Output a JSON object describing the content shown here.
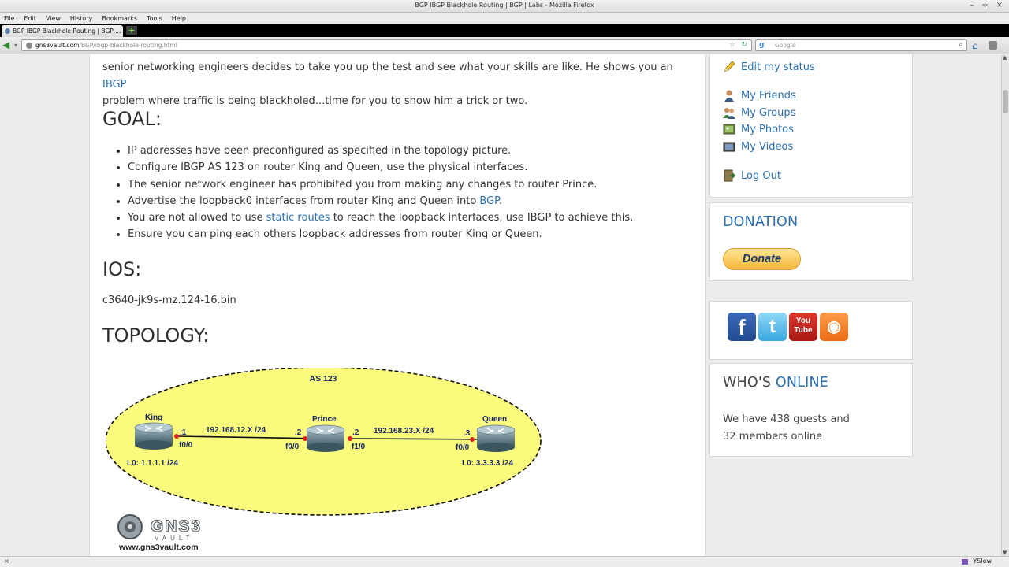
{
  "window": {
    "title": "BGP IBGP Blackhole Routing | BGP | Labs - Mozilla Firefox",
    "controls": [
      "–",
      "+",
      "×"
    ]
  },
  "menu": [
    "File",
    "Edit",
    "View",
    "History",
    "Bookmarks",
    "Tools",
    "Help"
  ],
  "tab": {
    "label": "BGP IBGP Blackhole Routing | BGP ...",
    "new_tab": "+"
  },
  "nav": {
    "url_host": "gns3vault.com",
    "url_path": "/BGP/ibgp-blackhole-routing.html",
    "search_placeholder": "Google"
  },
  "article": {
    "intro_line1": "senior networking engineers decides to take you up the test and see what your skills are like. He shows you an ",
    "intro_link": "IBGP",
    "intro_line2": "problem where traffic is being blackholed...time for you to show him a trick or two.",
    "goal_heading": "GOAL:",
    "goals": [
      {
        "text": "IP addresses have been preconfigured as specified in the topology picture."
      },
      {
        "text": "Configure IBGP AS 123 on router King and Queen, use the physical interfaces."
      },
      {
        "text": "The senior network engineer has prohibited you from making any changes to router Prince."
      },
      {
        "pre": "Advertise the loopback0 interfaces from router King and Queen into ",
        "link": "BGP",
        "post": "."
      },
      {
        "pre": "You are not allowed to use ",
        "link": "static routes",
        "post": " to reach the loopback interfaces, use IBGP to achieve this."
      },
      {
        "text": "Ensure you can ping each others loopback addresses from router King or Queen."
      }
    ],
    "ios_heading": "IOS:",
    "ios_file": "c3640-jk9s-mz.124-16.bin",
    "topology_heading": "TOPOLOGY:"
  },
  "topology": {
    "as_label": "AS 123",
    "routers": [
      {
        "name": "King",
        "loopback": "L0: 1.1.1.1 /24"
      },
      {
        "name": "Prince",
        "loopback": ""
      },
      {
        "name": "Queen",
        "loopback": "L0: 3.3.3.3 /24"
      }
    ],
    "links": [
      {
        "subnet": "192.168.12.X /24",
        "left_host": ".1",
        "left_if": "f0/0",
        "right_host": ".2",
        "right_if": "f0/0"
      },
      {
        "subnet": "192.168.23.X /24",
        "left_host": ".2",
        "left_if": "f1/0",
        "right_host": ".3",
        "right_if": "f0/0"
      }
    ],
    "logo_text": "GNS3",
    "logo_subtext": "VAULT",
    "site_url": "www.gns3vault.com"
  },
  "sidebar": {
    "menu": [
      {
        "label": "Edit my status",
        "icon": "pencil-icon"
      },
      {
        "label": "My Friends",
        "icon": "friends-icon"
      },
      {
        "label": "My Groups",
        "icon": "groups-icon"
      },
      {
        "label": "My Photos",
        "icon": "photos-icon"
      },
      {
        "label": "My Videos",
        "icon": "videos-icon"
      },
      {
        "label": "Log Out",
        "icon": "logout-icon"
      }
    ],
    "donation_title": "DONATION",
    "donate_button": "Donate",
    "social": [
      {
        "name": "facebook",
        "glyph": "f"
      },
      {
        "name": "twitter",
        "glyph": "t"
      },
      {
        "name": "youtube",
        "glyph_top": "You",
        "glyph_bottom": "Tube"
      },
      {
        "name": "rss",
        "glyph": "◉"
      }
    ],
    "online_title_pre": "WHO'S ",
    "online_title_accent": "ONLINE",
    "online_line1": "We have 438 guests and",
    "online_line2": "32 members online"
  },
  "status": {
    "left": "×",
    "right": "YSlow"
  },
  "colors": {
    "link": "#2a6fb0",
    "as_fill": "#fafa7d",
    "router_red": "#e02020"
  }
}
